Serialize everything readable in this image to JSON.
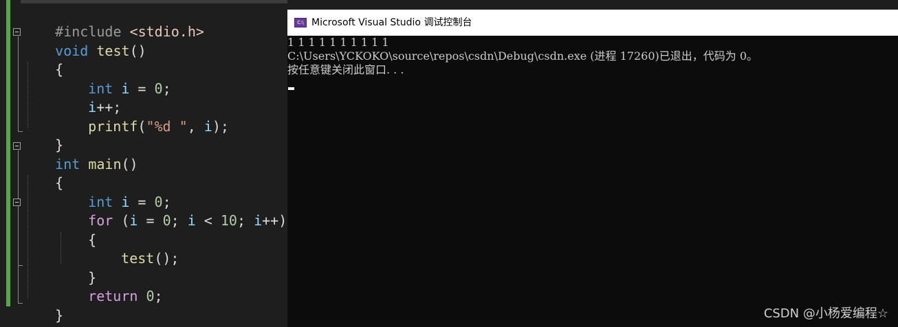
{
  "editor": {
    "lines": {
      "l1": [
        "#include ",
        "<stdio.h>"
      ],
      "l2": [
        "void",
        " ",
        "test",
        "()"
      ],
      "l3": [
        "{"
      ],
      "l4": [
        "int",
        " ",
        "i",
        " = ",
        "0",
        ";"
      ],
      "l5": [
        "i",
        "++;"
      ],
      "l6": [
        "printf",
        "(",
        "\"%d \"",
        ", ",
        "i",
        ");"
      ],
      "l7": [
        "}"
      ],
      "l8": [
        "int",
        " ",
        "main",
        "()"
      ],
      "l9": [
        "{"
      ],
      "l10": [
        "int",
        " ",
        "i",
        " = ",
        "0",
        ";"
      ],
      "l11": [
        "for",
        " (",
        "i",
        " = ",
        "0",
        "; ",
        "i",
        " < ",
        "10",
        "; ",
        "i",
        "++)"
      ],
      "l12": [
        "{"
      ],
      "l13": [
        "test",
        "();"
      ],
      "l14": [
        "}"
      ],
      "l15": [
        "return",
        " ",
        "0",
        ";"
      ],
      "l16": [
        "}"
      ]
    }
  },
  "console": {
    "icon_text": "C:\\",
    "title": "Microsoft Visual Studio 调试控制台",
    "output": [
      "1 1 1 1 1 1 1 1 1 1",
      "C:\\Users\\YCKOKO\\source\\repos\\csdn\\Debug\\csdn.exe (进程 17260)已退出，代码为 0。",
      "按任意键关闭此窗口. . ."
    ]
  },
  "watermark": "CSDN @小杨爱编程☆",
  "colors": {
    "editor_bg": "#1e1e1e",
    "keyword": "#569cd6",
    "control_keyword": "#d8a0df",
    "function": "#dcdcaa",
    "variable": "#9cdcfe",
    "number": "#b5cea8",
    "string": "#d69d85",
    "console_bg": "#0c0c0c",
    "console_text": "#cccccc"
  }
}
